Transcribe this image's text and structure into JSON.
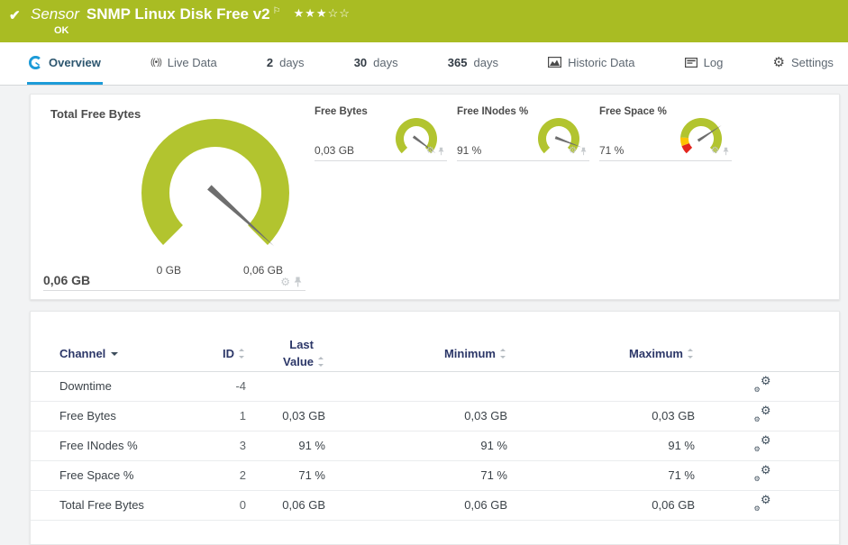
{
  "colors": {
    "status_green": "#a9bc23",
    "gauge_green": "#b2c42f",
    "accent_blue": "#1d9bd8",
    "warn_orange": "#fdc300",
    "error_red": "#e3251d",
    "table_header_navy": "#2c3768"
  },
  "header": {
    "kind": "Sensor",
    "title": "SNMP Linux Disk Free v2",
    "status": "OK",
    "stars_filled": "★★★",
    "stars_empty": "☆☆"
  },
  "tabs": [
    {
      "label": "Overview"
    },
    {
      "label": "Live Data"
    },
    {
      "num": "2",
      "unit": "days"
    },
    {
      "num": "30",
      "unit": "days"
    },
    {
      "num": "365",
      "unit": "days"
    },
    {
      "label": "Historic Data"
    },
    {
      "label": "Log"
    },
    {
      "label": "Settings"
    }
  ],
  "gauges": {
    "main": {
      "title": "Total Free Bytes",
      "value": "0,06 GB",
      "scale_min_label": "0 GB",
      "scale_max_label": "0,06 GB",
      "percent": 99,
      "segments": [
        {
          "from": 0,
          "to": 100,
          "color": "#b2c42f"
        }
      ]
    },
    "small": [
      {
        "title": "Free Bytes",
        "value": "0,03 GB",
        "percent": 97,
        "segments": [
          {
            "from": 0,
            "to": 100,
            "color": "#b2c42f"
          }
        ]
      },
      {
        "title": "Free INodes %",
        "value": "91 %",
        "percent": 91,
        "segments": [
          {
            "from": 0,
            "to": 100,
            "color": "#b2c42f"
          }
        ]
      },
      {
        "title": "Free Space %",
        "value": "71 %",
        "percent": 71,
        "segments": [
          {
            "from": 0,
            "to": 9,
            "color": "#e3251d"
          },
          {
            "from": 9,
            "to": 18,
            "color": "#fdc300"
          },
          {
            "from": 18,
            "to": 100,
            "color": "#b2c42f"
          }
        ]
      }
    ]
  },
  "table": {
    "columns": {
      "channel": "Channel",
      "id": "ID",
      "last": "Last Value",
      "min": "Minimum",
      "max": "Maximum"
    },
    "rows": [
      {
        "channel": "Downtime",
        "id": "-4",
        "last": "",
        "min": "",
        "max": ""
      },
      {
        "channel": "Free Bytes",
        "id": "1",
        "last": "0,03 GB",
        "min": "0,03 GB",
        "max": "0,03 GB"
      },
      {
        "channel": "Free INodes %",
        "id": "3",
        "last": "91 %",
        "min": "91 %",
        "max": "91 %"
      },
      {
        "channel": "Free Space %",
        "id": "2",
        "last": "71 %",
        "min": "71 %",
        "max": "71 %"
      },
      {
        "channel": "Total Free Bytes",
        "id": "0",
        "last": "0,06 GB",
        "min": "0,06 GB",
        "max": "0,06 GB"
      }
    ]
  }
}
